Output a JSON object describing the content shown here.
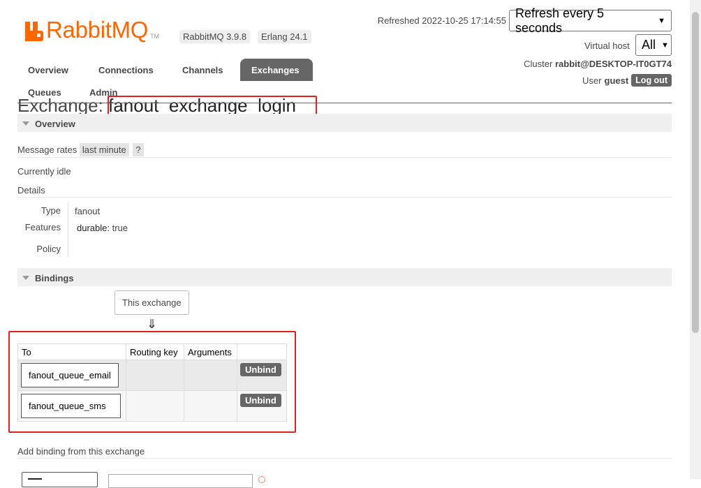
{
  "header": {
    "logo_text": "RabbitMQ",
    "logo_tm": "TM",
    "version": "RabbitMQ 3.9.8",
    "erlang": "Erlang 24.1",
    "refreshed": "Refreshed 2022-10-25 17:14:55",
    "refresh_select": "Refresh every 5 seconds",
    "vhost_label": "Virtual host",
    "vhost_select": "All",
    "cluster_label": "Cluster",
    "cluster_name": "rabbit@DESKTOP-IT0GT74",
    "user_label": "User",
    "user_name": "guest",
    "logout": "Log out"
  },
  "nav": {
    "overview": "Overview",
    "connections": "Connections",
    "channels": "Channels",
    "exchanges": "Exchanges",
    "queues": "Queues",
    "admin": "Admin"
  },
  "page": {
    "title_prefix": "Exchange:",
    "exchange_name": "fanout_exchange_login"
  },
  "overview": {
    "header": "Overview",
    "message_rates_label": "Message rates",
    "message_rates_value": "last minute",
    "help": "?",
    "status": "Currently idle",
    "details_label": "Details",
    "type_label": "Type",
    "type_value": "fanout",
    "features_label": "Features",
    "feature_key": "durable:",
    "feature_value": "true",
    "policy_label": "Policy"
  },
  "bindings": {
    "header": "Bindings",
    "this_exchange": "This exchange",
    "arrow": "⇓",
    "columns": [
      "To",
      "Routing key",
      "Arguments"
    ],
    "rows": [
      {
        "to": "fanout_queue_email",
        "routing_key": "",
        "arguments": "",
        "action": "Unbind"
      },
      {
        "to": "fanout_queue_sms",
        "routing_key": "",
        "arguments": "",
        "action": "Unbind"
      }
    ]
  },
  "add_binding": {
    "header": "Add binding from this exchange"
  },
  "colors": {
    "brand": "#ff6600",
    "nav_active": "#666666",
    "highlight_box": "#e02020"
  }
}
